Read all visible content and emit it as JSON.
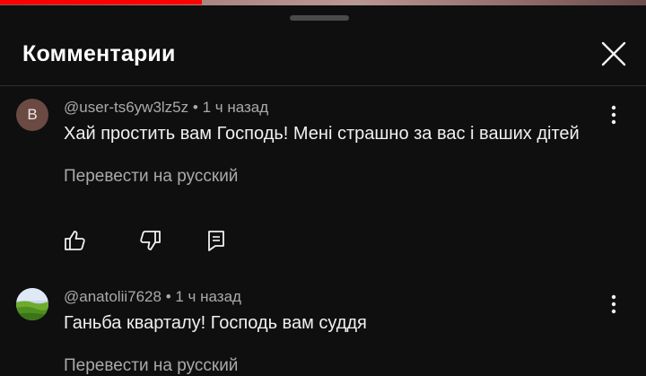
{
  "panel": {
    "title": "Комментарии",
    "close_icon": "close-icon"
  },
  "comments": [
    {
      "author": "@user-ts6yw3lz5z",
      "time": "1 ч назад",
      "avatar_letter": "В",
      "avatar_color": "#6b4a44",
      "text": "Хай простить вам Господь! Мені страшно за вас і ваших дітей",
      "translate_label": "Перевести на русский",
      "actions": [
        "like-icon",
        "dislike-icon",
        "reply-icon"
      ]
    },
    {
      "author": "@anatolii7628",
      "time": "1 ч назад",
      "avatar_image": "landscape-photo",
      "text": "Ганьба кварталу! Господь вам суддя",
      "translate_label": "Перевести на русский"
    }
  ],
  "colors": {
    "background": "#0f0f0f",
    "primary_text": "#f1f1f1",
    "secondary_text": "#aaaaaa",
    "progress_red": "#ff0000"
  }
}
